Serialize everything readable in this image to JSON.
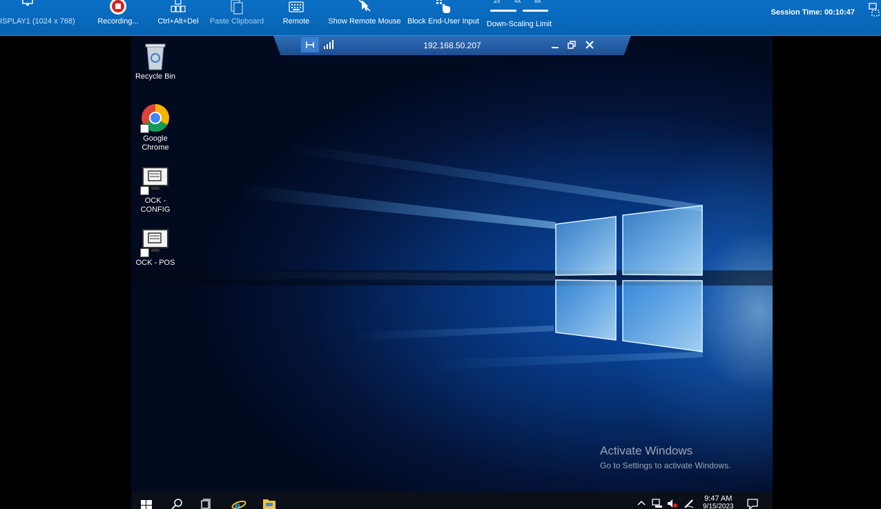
{
  "toolbar": {
    "display_label": "ISPLAY1 (1024 x 768)",
    "recording_label": "Recording...",
    "ctrlaltdel_label": "Ctrl+Alt+Del",
    "paste_clipboard_label": "Paste Clipboard",
    "remote_label": "Remote",
    "show_mouse_label": "Show Remote Mouse",
    "block_input_label": "Block End-User Input",
    "scaling": {
      "label": "Down-Scaling Limit",
      "options": [
        "2x",
        "4x",
        "8x"
      ]
    },
    "session_time": "Session Time: 00:10:47"
  },
  "rdp_bar": {
    "ip": "192.168.50.207"
  },
  "desktop": {
    "icons": [
      {
        "label": "Recycle Bin"
      },
      {
        "label": "Google\nChrome"
      },
      {
        "label": "OCK -\nCONFIG"
      },
      {
        "label": "OCK - POS"
      }
    ],
    "watermark": {
      "title": "Activate Windows",
      "subtitle": "Go to Settings to activate Windows."
    }
  },
  "taskbar": {
    "time": "9:47 AM",
    "date": "9/15/2023"
  },
  "colors": {
    "toolbar_blue": "#0763b3",
    "record_red": "#e02020",
    "desktop_blue": "#0a4fb0"
  }
}
